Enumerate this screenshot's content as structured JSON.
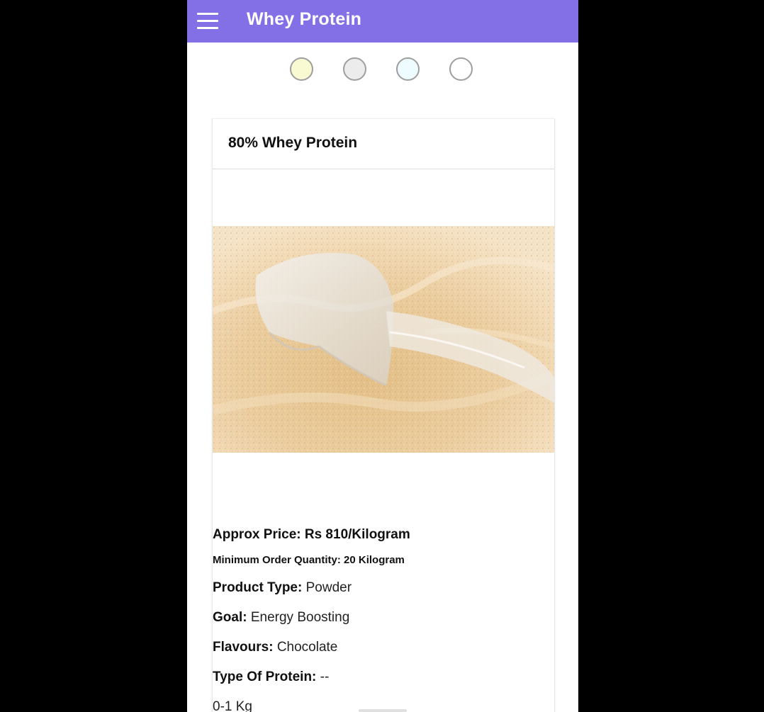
{
  "appbar": {
    "title": "Whey Protein",
    "menu_icon": "hamburger-menu-icon",
    "color": "#8470e6"
  },
  "swatches": [
    {
      "name": "cream",
      "color": "#f9f9d2"
    },
    {
      "name": "light-grey",
      "color": "#ececec"
    },
    {
      "name": "pale-blue",
      "color": "#eefbff"
    },
    {
      "name": "white",
      "color": "#ffffff"
    }
  ],
  "product": {
    "title": "80% Whey Protein",
    "image_alt": "whey protein powder with scoop",
    "price": "Approx Price: Rs 810/Kilogram",
    "moq": "Minimum Order Quantity: 20 Kilogram",
    "specs": [
      {
        "key": "Product Type:",
        "value": "Powder"
      },
      {
        "key": "Goal:",
        "value": "Energy Boosting"
      },
      {
        "key": "Flavours:",
        "value": "Chocolate"
      },
      {
        "key": "Type Of Protein:",
        "value": "--"
      }
    ],
    "extra_line": "0-1 Kg"
  }
}
